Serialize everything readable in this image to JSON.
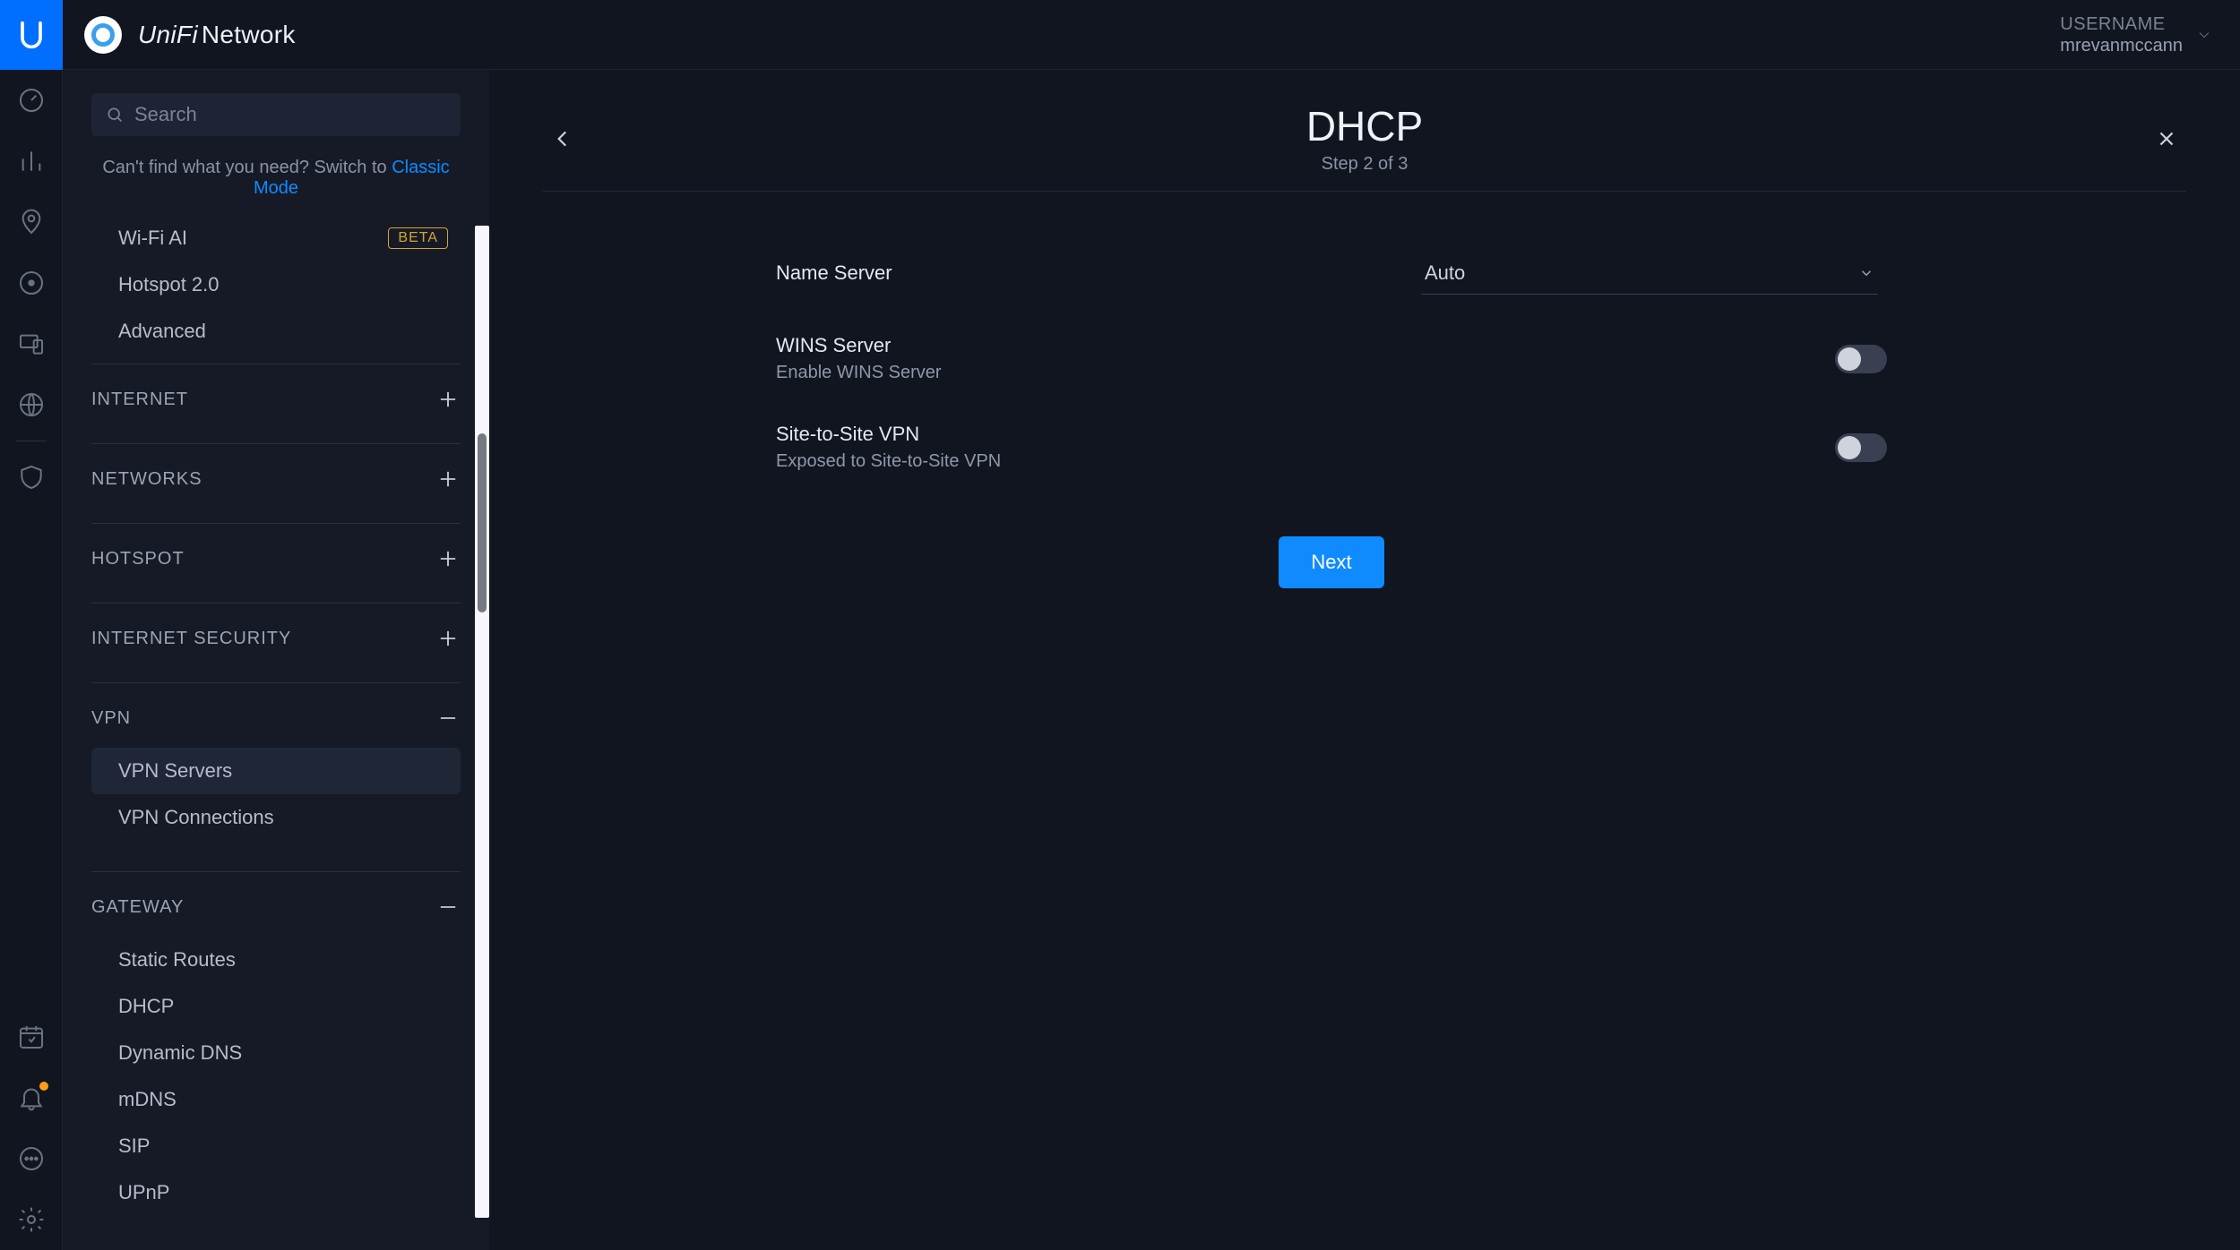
{
  "header": {
    "brand1": "UniFi",
    "brand2": "Network",
    "user_label": "USERNAME",
    "user_name": "mrevanmccann"
  },
  "sidebar": {
    "search_placeholder": "Search",
    "hint_prefix": "Can't find what you need? Switch to ",
    "hint_link": "Classic Mode",
    "top_items": [
      {
        "label": "Wi-Fi AI",
        "badge": "BETA"
      },
      {
        "label": "Hotspot 2.0"
      },
      {
        "label": "Advanced"
      }
    ],
    "groups": {
      "internet": "INTERNET",
      "networks": "NETWORKS",
      "hotspot": "HOTSPOT",
      "internet_security": "INTERNET SECURITY",
      "vpn": "VPN",
      "gateway": "GATEWAY"
    },
    "vpn_items": [
      {
        "label": "VPN Servers",
        "active": true
      },
      {
        "label": "VPN Connections"
      }
    ],
    "gateway_items": [
      {
        "label": "Static Routes"
      },
      {
        "label": "DHCP"
      },
      {
        "label": "Dynamic DNS"
      },
      {
        "label": "mDNS"
      },
      {
        "label": "SIP"
      },
      {
        "label": "UPnP"
      }
    ]
  },
  "main": {
    "title": "DHCP",
    "step": "Step 2 of 3",
    "name_server_label": "Name Server",
    "name_server_value": "Auto",
    "wins_label": "WINS Server",
    "wins_sub": "Enable WINS Server",
    "s2s_label": "Site-to-Site VPN",
    "s2s_sub": "Exposed to Site-to-Site VPN",
    "next": "Next"
  }
}
